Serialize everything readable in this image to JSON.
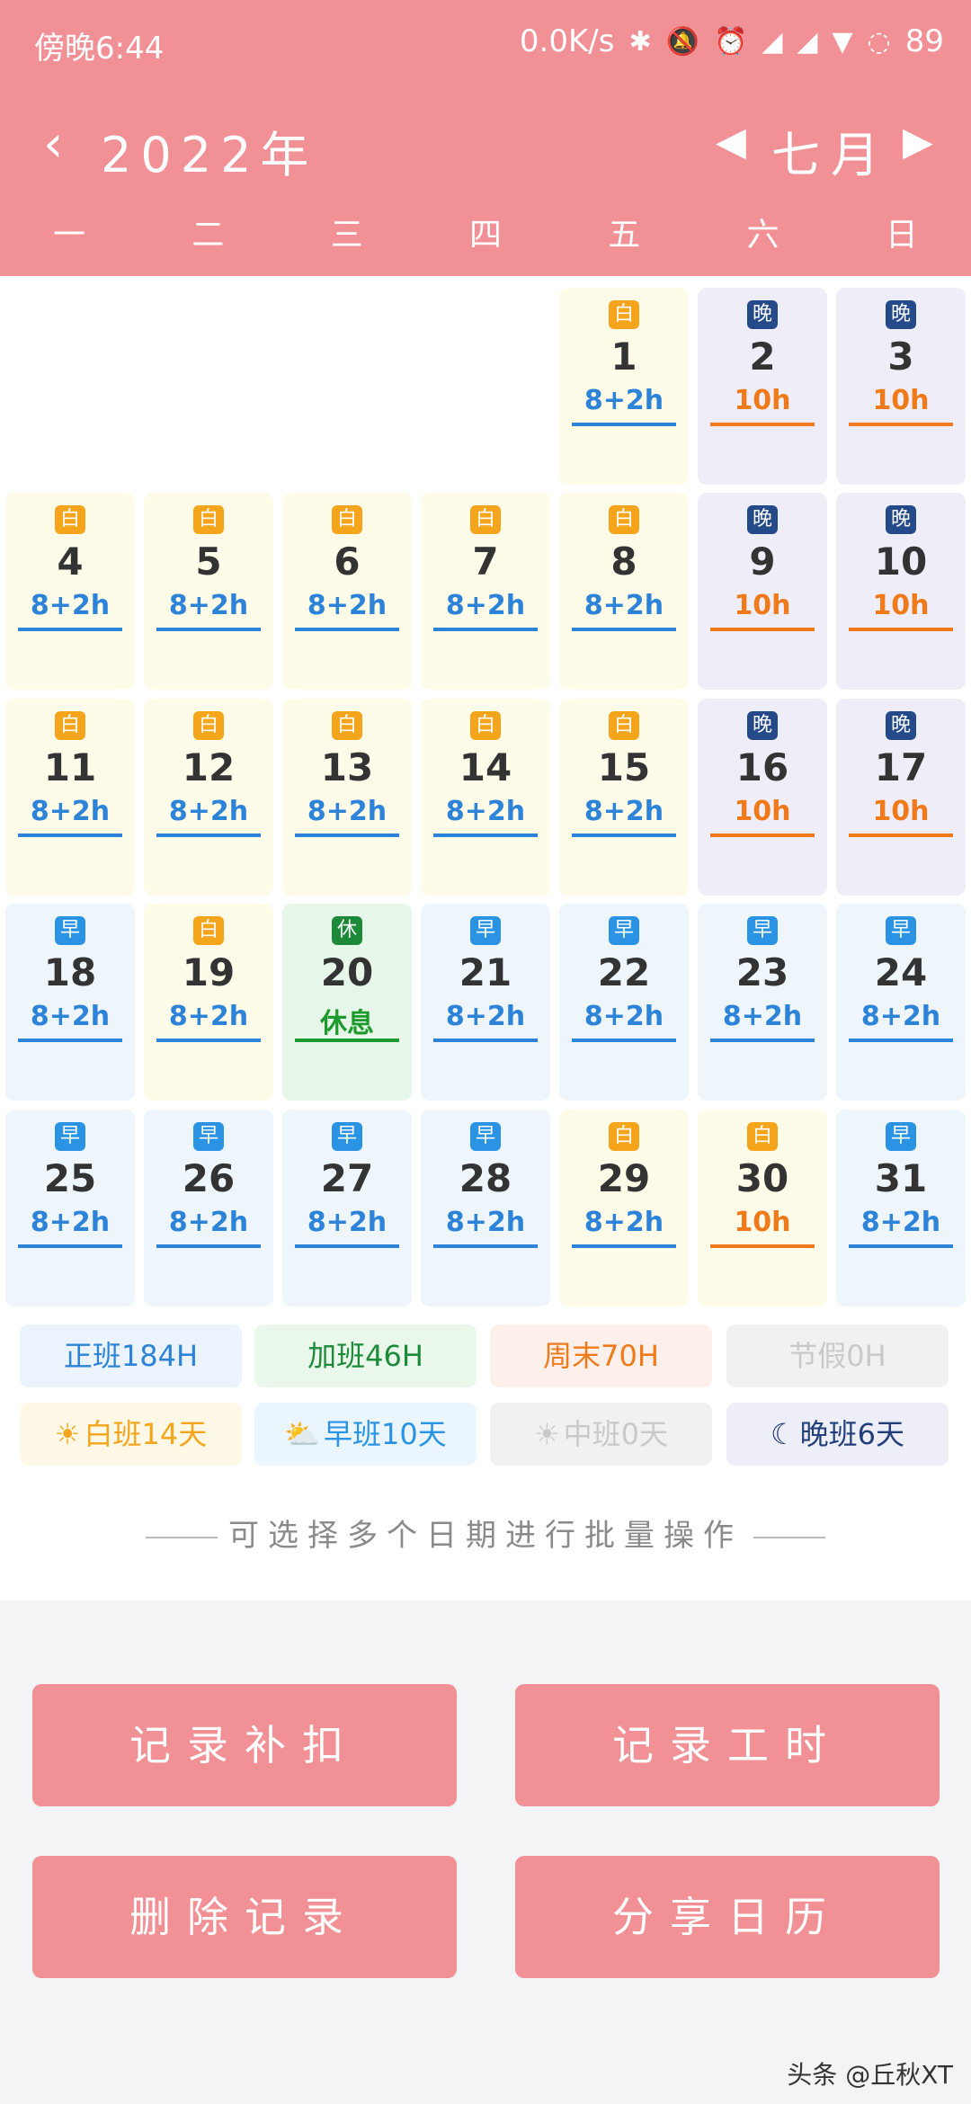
{
  "status_bar": {
    "time": "傍晚6:44",
    "net_speed": "0.0K/s",
    "battery": "89",
    "icons": [
      "bluetooth-icon",
      "mute-icon",
      "alarm-icon",
      "hd-signal-icon",
      "signal-icon",
      "wifi-icon",
      "battery-ring-icon"
    ]
  },
  "header": {
    "prev_year_icon": "chevron-left-icon",
    "year": "2022年",
    "prev_month_icon": "triangle-left-icon",
    "month": "七月",
    "next_month_icon": "triangle-right-icon",
    "weekdays": [
      "一",
      "二",
      "三",
      "四",
      "五",
      "六",
      "日"
    ]
  },
  "calendar": {
    "days": [
      {
        "day": "1",
        "tag": "白",
        "hours": "8+2h",
        "shift": "bai",
        "color": "blue"
      },
      {
        "day": "2",
        "tag": "晚",
        "hours": "10h",
        "shift": "wan",
        "color": "orange"
      },
      {
        "day": "3",
        "tag": "晚",
        "hours": "10h",
        "shift": "wan",
        "color": "orange"
      },
      {
        "day": "4",
        "tag": "白",
        "hours": "8+2h",
        "shift": "bai",
        "color": "blue"
      },
      {
        "day": "5",
        "tag": "白",
        "hours": "8+2h",
        "shift": "bai",
        "color": "blue"
      },
      {
        "day": "6",
        "tag": "白",
        "hours": "8+2h",
        "shift": "bai",
        "color": "blue"
      },
      {
        "day": "7",
        "tag": "白",
        "hours": "8+2h",
        "shift": "bai",
        "color": "blue"
      },
      {
        "day": "8",
        "tag": "白",
        "hours": "8+2h",
        "shift": "bai",
        "color": "blue"
      },
      {
        "day": "9",
        "tag": "晚",
        "hours": "10h",
        "shift": "wan",
        "color": "orange"
      },
      {
        "day": "10",
        "tag": "晚",
        "hours": "10h",
        "shift": "wan",
        "color": "orange"
      },
      {
        "day": "11",
        "tag": "白",
        "hours": "8+2h",
        "shift": "bai",
        "color": "blue"
      },
      {
        "day": "12",
        "tag": "白",
        "hours": "8+2h",
        "shift": "bai",
        "color": "blue"
      },
      {
        "day": "13",
        "tag": "白",
        "hours": "8+2h",
        "shift": "bai",
        "color": "blue"
      },
      {
        "day": "14",
        "tag": "白",
        "hours": "8+2h",
        "shift": "bai",
        "color": "blue"
      },
      {
        "day": "15",
        "tag": "白",
        "hours": "8+2h",
        "shift": "bai",
        "color": "blue"
      },
      {
        "day": "16",
        "tag": "晚",
        "hours": "10h",
        "shift": "wan",
        "color": "orange"
      },
      {
        "day": "17",
        "tag": "晚",
        "hours": "10h",
        "shift": "wan",
        "color": "orange"
      },
      {
        "day": "18",
        "tag": "早",
        "hours": "8+2h",
        "shift": "zao",
        "color": "blue"
      },
      {
        "day": "19",
        "tag": "白",
        "hours": "8+2h",
        "shift": "bai",
        "color": "blue"
      },
      {
        "day": "20",
        "tag": "休",
        "hours": "休息",
        "shift": "xiu",
        "color": "green"
      },
      {
        "day": "21",
        "tag": "早",
        "hours": "8+2h",
        "shift": "zao",
        "color": "blue"
      },
      {
        "day": "22",
        "tag": "早",
        "hours": "8+2h",
        "shift": "zao",
        "color": "blue"
      },
      {
        "day": "23",
        "tag": "早",
        "hours": "8+2h",
        "shift": "zao",
        "color": "blue"
      },
      {
        "day": "24",
        "tag": "早",
        "hours": "8+2h",
        "shift": "zao",
        "color": "blue"
      },
      {
        "day": "25",
        "tag": "早",
        "hours": "8+2h",
        "shift": "zao",
        "color": "blue"
      },
      {
        "day": "26",
        "tag": "早",
        "hours": "8+2h",
        "shift": "zao",
        "color": "blue"
      },
      {
        "day": "27",
        "tag": "早",
        "hours": "8+2h",
        "shift": "zao",
        "color": "blue"
      },
      {
        "day": "28",
        "tag": "早",
        "hours": "8+2h",
        "shift": "zao",
        "color": "blue"
      },
      {
        "day": "29",
        "tag": "白",
        "hours": "8+2h",
        "shift": "bai",
        "color": "blue"
      },
      {
        "day": "30",
        "tag": "白",
        "hours": "10h",
        "shift": "bai",
        "color": "orange"
      },
      {
        "day": "31",
        "tag": "早",
        "hours": "8+2h",
        "shift": "zao",
        "color": "blue"
      }
    ]
  },
  "summary": {
    "regular": "正班184H",
    "overtime": "加班46H",
    "weekend": "周末70H",
    "holiday": "节假0H",
    "day_shift": "白班14天",
    "morning_shift": "早班10天",
    "middle_shift": "中班0天",
    "night_shift": "晚班6天",
    "icons": {
      "day_shift": "sun-icon",
      "morning_shift": "cloud-sun-icon",
      "middle_shift": "sun-gray-icon",
      "night_shift": "moon-icon"
    }
  },
  "hint": "可选择多个日期进行批量操作",
  "actions": {
    "record_deduction": "记录补扣",
    "record_hours": "记录工时",
    "delete_record": "删除记录",
    "share_calendar": "分享日历"
  },
  "watermark": "头条 @丘秋XT",
  "colors": {
    "header": "#f19095",
    "blue": "#2c83d8",
    "orange": "#f07a1a",
    "green": "#1d9a2d"
  }
}
